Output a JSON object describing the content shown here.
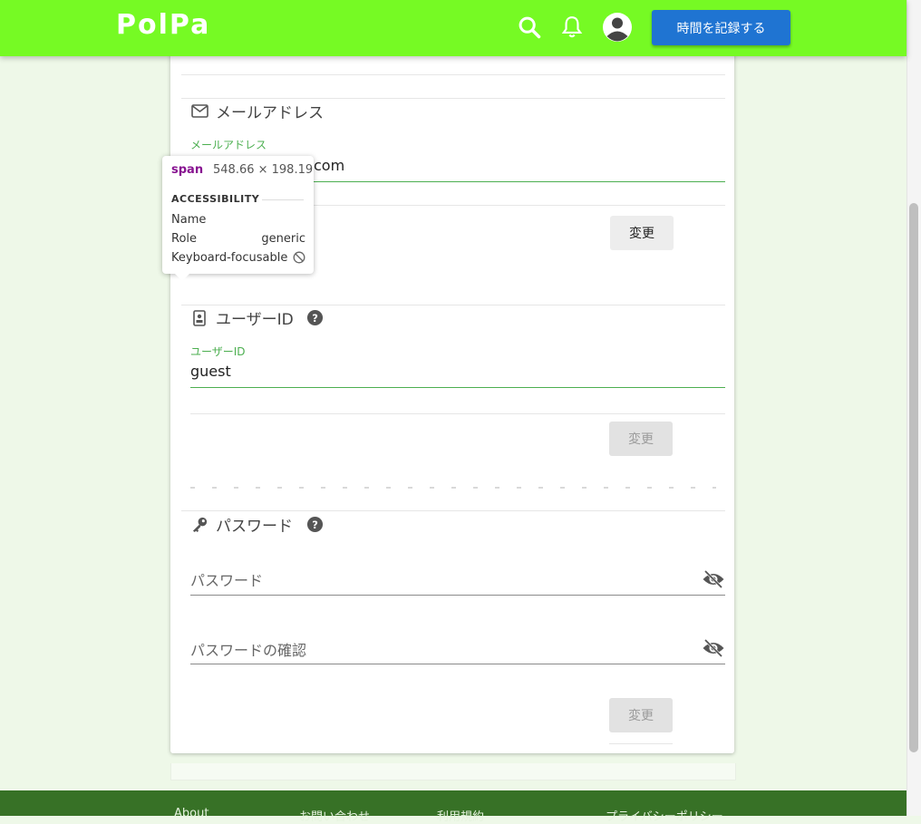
{
  "header": {
    "brand": "PolPa",
    "record_button": "時間を記録する",
    "icons": [
      "search-icon",
      "bell-icon",
      "account-icon"
    ],
    "color": "#76fa24"
  },
  "email_section": {
    "title": "メールアドレス",
    "field_label": "メールアドレス",
    "value_suffix": "com",
    "change_button": "変更"
  },
  "userid_section": {
    "title": "ユーザーID",
    "field_label": "ユーザーID",
    "value": "guest",
    "change_button": "変更"
  },
  "password_section": {
    "title": "パスワード",
    "password_placeholder": "パスワード",
    "confirm_placeholder": "パスワードの確認",
    "change_button": "変更"
  },
  "devtools_tooltip": {
    "tag": "span",
    "size": "548.66 × 198.19",
    "section": "ACCESSIBILITY",
    "rows": [
      {
        "key": "Name",
        "value": ""
      },
      {
        "key": "Role",
        "value": "generic"
      },
      {
        "key": "Keyboard-focusable",
        "value": ""
      }
    ]
  },
  "footer": {
    "links": [
      "About",
      "お問い合わせ",
      "利用規約",
      "プライバシーポリシー"
    ],
    "color": "#377126"
  }
}
